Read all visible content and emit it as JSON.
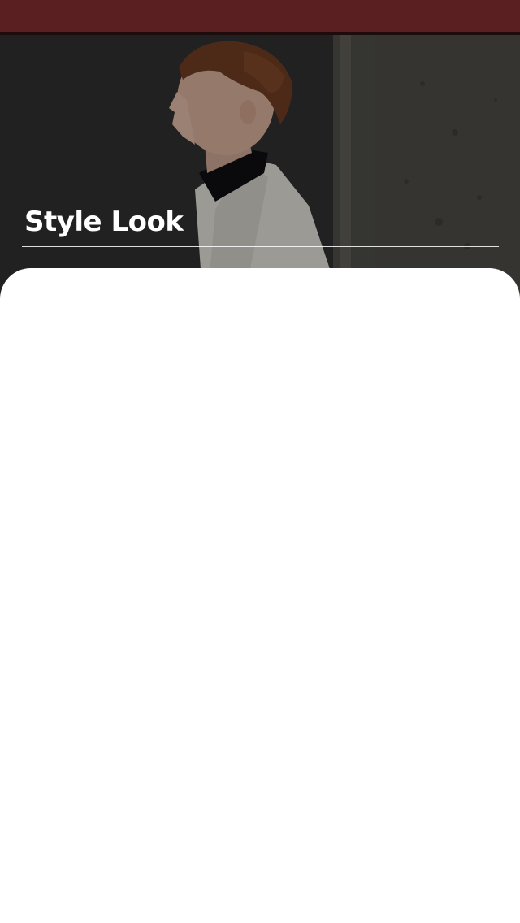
{
  "status_bar": {
    "color": "#5a1f21"
  },
  "hero": {
    "image": "man-profile-photo",
    "title": "Style Look"
  },
  "content": {
    "background": "#ffffff"
  }
}
